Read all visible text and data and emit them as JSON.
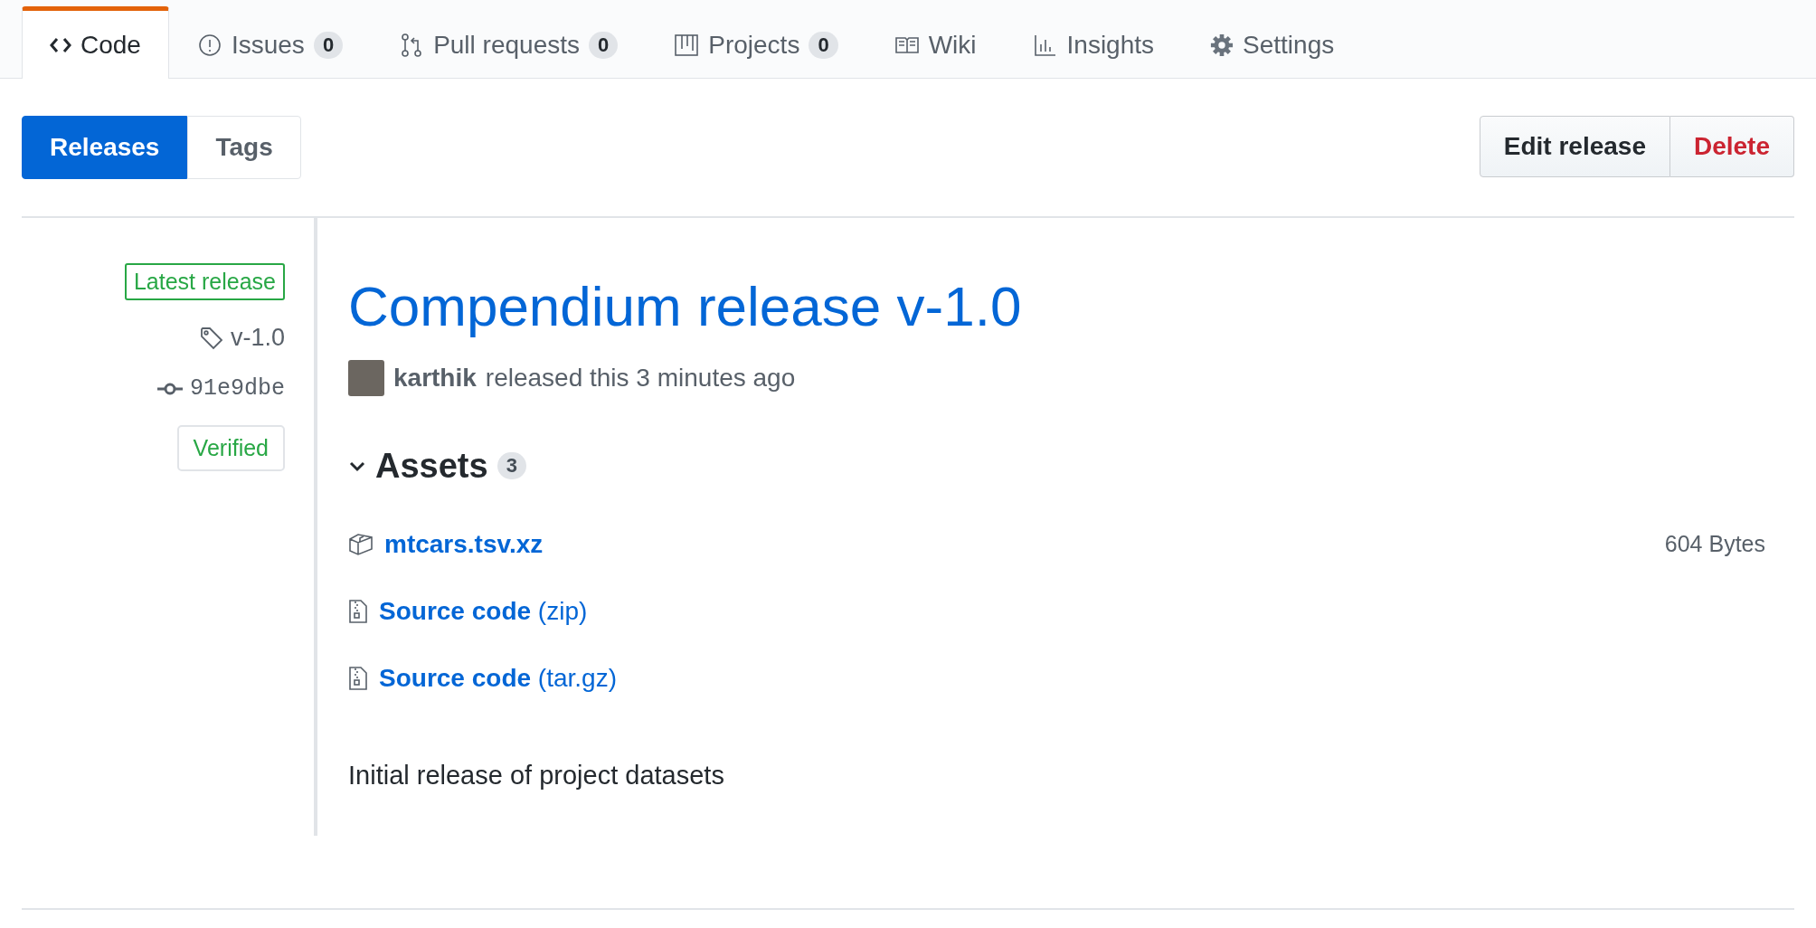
{
  "tabs": [
    {
      "label": "Code",
      "kind": "code",
      "selected": true
    },
    {
      "label": "Issues",
      "kind": "issue",
      "counter": "0",
      "selected": false
    },
    {
      "label": "Pull requests",
      "kind": "pr",
      "counter": "0",
      "selected": false
    },
    {
      "label": "Projects",
      "kind": "project",
      "counter": "0",
      "selected": false
    },
    {
      "label": "Wiki",
      "kind": "book",
      "selected": false
    },
    {
      "label": "Insights",
      "kind": "graph",
      "selected": false
    },
    {
      "label": "Settings",
      "kind": "gear",
      "selected": false
    }
  ],
  "subnav": [
    {
      "label": "Releases",
      "selected": true
    },
    {
      "label": "Tags",
      "selected": false
    }
  ],
  "actions": [
    {
      "label": "Edit release",
      "kind": "normal"
    },
    {
      "label": "Delete",
      "kind": "danger"
    }
  ],
  "sidebar": {
    "badge": "Latest release",
    "tag": "v-1.0",
    "commit": "91e9dbe",
    "verified": "Verified"
  },
  "release": {
    "title": "Compendium release v-1.0",
    "author": "karthik",
    "meta": "released this 3 minutes ago",
    "assets_heading": "Assets",
    "assets_count": "3",
    "assets_expanded": true,
    "assets": [
      {
        "kind": "package",
        "label": "**mtcars.tsv.xz**",
        "size": "604 Bytes"
      },
      {
        "kind": "archive",
        "label": "**Source code** (zip)"
      },
      {
        "kind": "archive",
        "label": "**Source code** (tar.gz)"
      }
    ],
    "body": "Initial release of project datasets"
  }
}
